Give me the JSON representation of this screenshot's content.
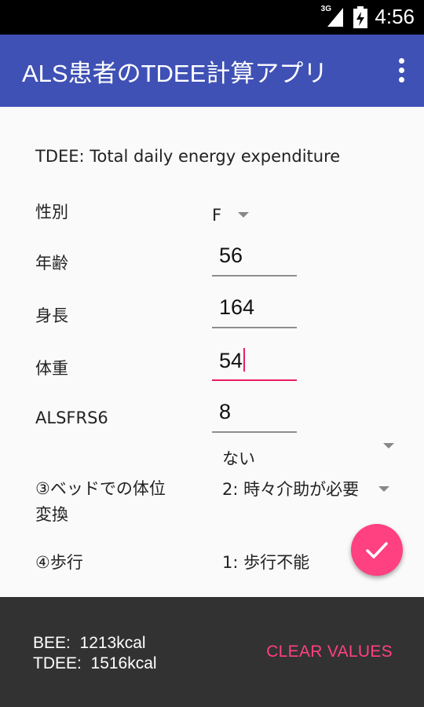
{
  "status_bar": {
    "network": "3G",
    "time": "4:56"
  },
  "app_bar": {
    "title": "ALS患者のTDEE計算アプリ",
    "menu_icon": "more-vert-icon"
  },
  "description": "TDEE: Total daily energy expenditure",
  "form": {
    "sex": {
      "label": "性別",
      "value": "F"
    },
    "age": {
      "label": "年齢",
      "value": "56"
    },
    "height": {
      "label": "身長",
      "value": "164"
    },
    "weight": {
      "label": "体重",
      "value": "54"
    },
    "alsfrs6": {
      "label": "ALSFRS6",
      "value": "8"
    },
    "partial_option": "ない",
    "bed_position": {
      "label_line1": "③ベッドでの体位",
      "label_line2": "変換",
      "value": "2: 時々介助が必要"
    },
    "walking": {
      "label": "④歩行",
      "value": "1: 歩行不能"
    }
  },
  "results": {
    "bee": "BEE:  1213kcal",
    "tdee": "TDEE:  1516kcal"
  },
  "actions": {
    "clear_label": "CLEAR VALUES",
    "fab_icon": "check-icon"
  },
  "colors": {
    "primary": "#3f51b5",
    "accent": "#ff4081",
    "focus_underline": "#e91e63",
    "snackbar": "#323232"
  }
}
